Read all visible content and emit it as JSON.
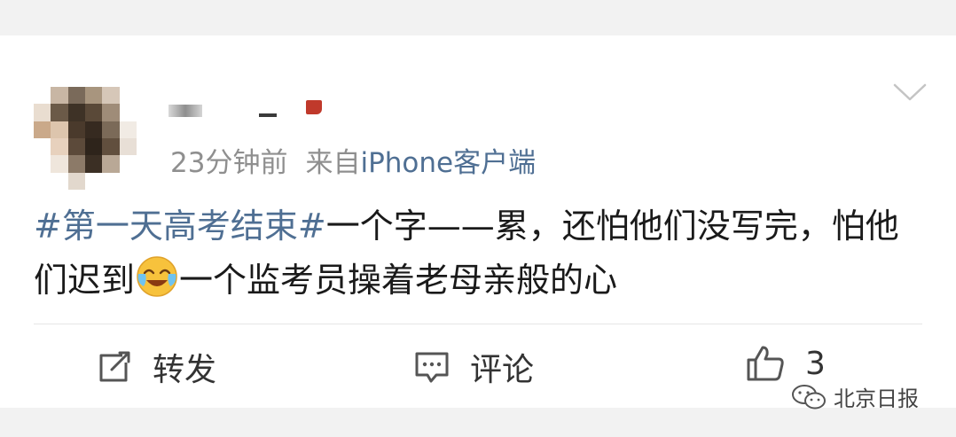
{
  "post": {
    "time": "23分钟前",
    "source_prefix": "来自",
    "source_client": "iPhone客户端",
    "hashtag": "#第一天高考结束#",
    "text_part1": "一个字——累，还怕他们没写完，怕他们迟到",
    "text_part2": "一个监考员操着老母亲般的心"
  },
  "actions": {
    "repost_label": "转发",
    "comment_label": "评论",
    "like_count": "3"
  },
  "watermark": {
    "text": "北京日报"
  },
  "icons": [
    "chevron-down-icon",
    "repost-icon",
    "comment-icon",
    "like-icon",
    "laughing-crying-emoji",
    "wechat-icon"
  ],
  "colors": {
    "link": "#4f6f93",
    "meta": "#8f8f8f",
    "text": "#1a1a1a",
    "background": "#f2f2f2",
    "card": "#ffffff"
  }
}
